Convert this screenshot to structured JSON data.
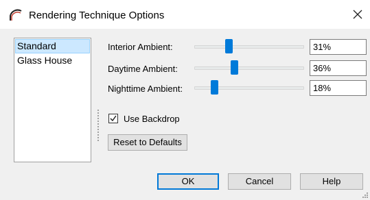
{
  "window": {
    "title": "Rendering Technique Options",
    "icon": "arc-icon",
    "close_icon": "close-icon"
  },
  "techniques": [
    {
      "label": "Standard",
      "selected": true
    },
    {
      "label": "Glass House",
      "selected": false
    }
  ],
  "settings": [
    {
      "label": "Interior Ambient:",
      "value": "31%",
      "level": 0.31
    },
    {
      "label": "Daytime Ambient:",
      "value": "36%",
      "level": 0.36
    },
    {
      "label": "Nighttime Ambient:",
      "value": "18%",
      "level": 0.18
    }
  ],
  "use_backdrop": {
    "label": "Use Backdrop",
    "checked": true
  },
  "reset_label": "Reset to Defaults",
  "buttons": {
    "ok": "OK",
    "cancel": "Cancel",
    "help": "Help"
  },
  "colors": {
    "accent": "#007ad9",
    "selection": "#cce8ff",
    "default_border": "#0078d7"
  }
}
